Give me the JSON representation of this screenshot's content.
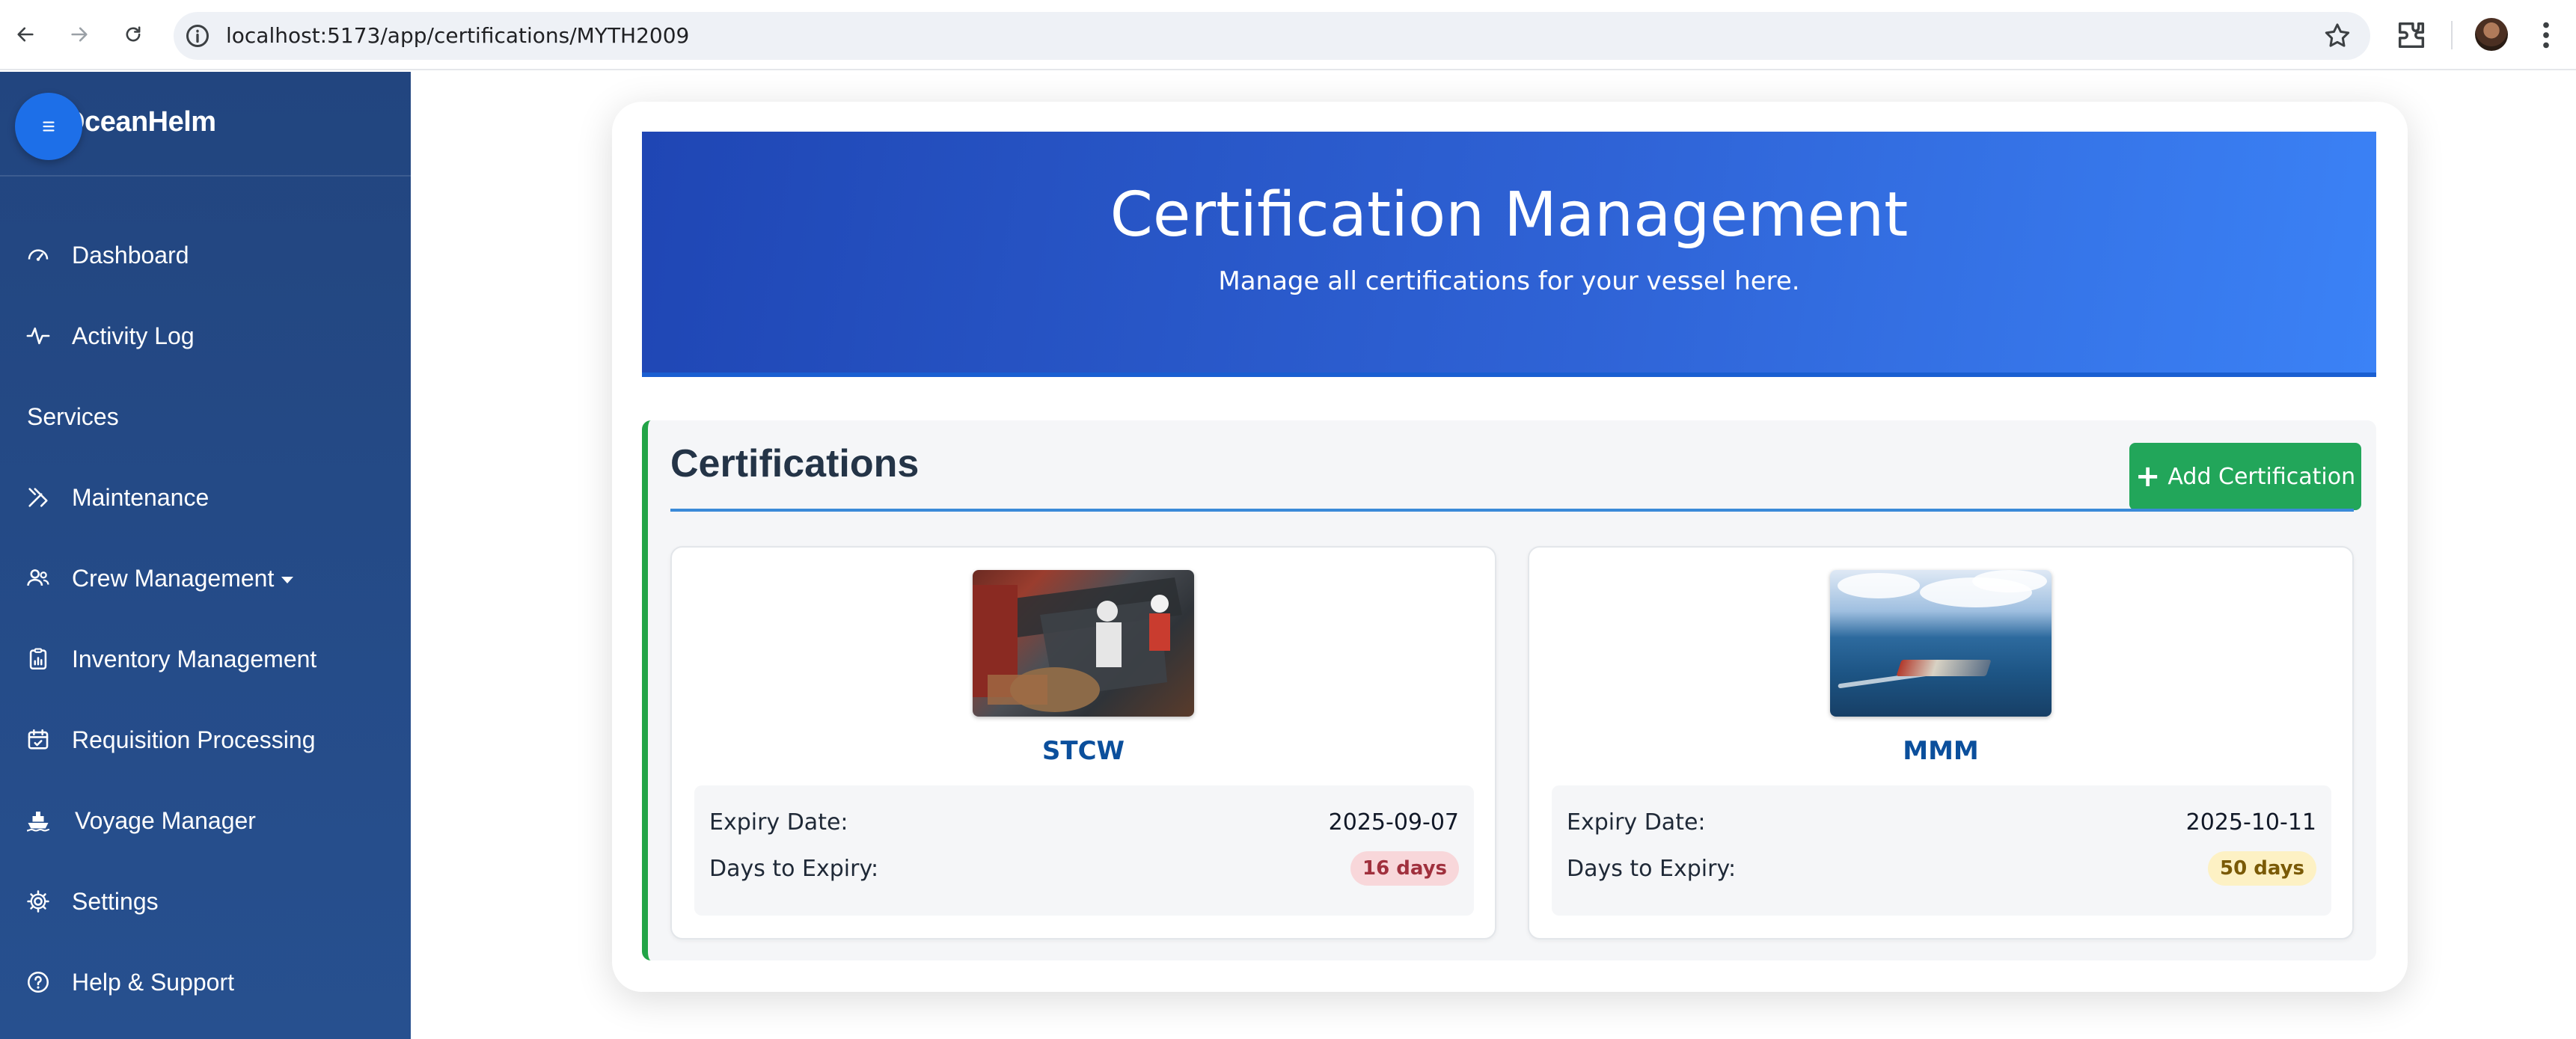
{
  "browser": {
    "url": "localhost:5173/app/certifications/MYTH2009"
  },
  "sidebar": {
    "brand": "OceanHelm",
    "items": [
      {
        "label": "Dashboard",
        "icon": "gauge-icon"
      },
      {
        "label": "Activity Log",
        "icon": "activity-icon"
      },
      {
        "label": "Services",
        "icon": ""
      },
      {
        "label": "Maintenance",
        "icon": "tools-icon"
      },
      {
        "label": "Crew Management",
        "icon": "people-icon"
      },
      {
        "label": "Inventory Management",
        "icon": "clipboard-chart-icon"
      },
      {
        "label": "Requisition Processing",
        "icon": "calendar-check-icon"
      },
      {
        "label": "Voyage Manager",
        "icon": "ship-icon"
      },
      {
        "label": "Settings",
        "icon": "gear-icon"
      },
      {
        "label": "Help & Support",
        "icon": "question-circle-icon"
      }
    ]
  },
  "hero": {
    "title": "Certification Management",
    "subtitle": "Manage all certifications for your vessel here."
  },
  "certifications": {
    "heading": "Certifications",
    "add_button": "Add Certification",
    "cards": [
      {
        "name": "STCW",
        "expiry_label": "Expiry Date:",
        "expiry_date": "2025-09-07",
        "days_label": "Days to Expiry:",
        "days": "16 days",
        "status_color": "#f8d7da"
      },
      {
        "name": "MMM",
        "expiry_label": "Expiry Date:",
        "expiry_date": "2025-10-11",
        "days_label": "Days to Expiry:",
        "days": "50 days",
        "status_color": "#fdf1c4"
      }
    ]
  },
  "colors": {
    "sidebar": "#22457f",
    "hero_start": "#1f46b4",
    "hero_end": "#3b82f6",
    "accent_green": "#22a65a",
    "cert_name": "#0b4f9c"
  }
}
